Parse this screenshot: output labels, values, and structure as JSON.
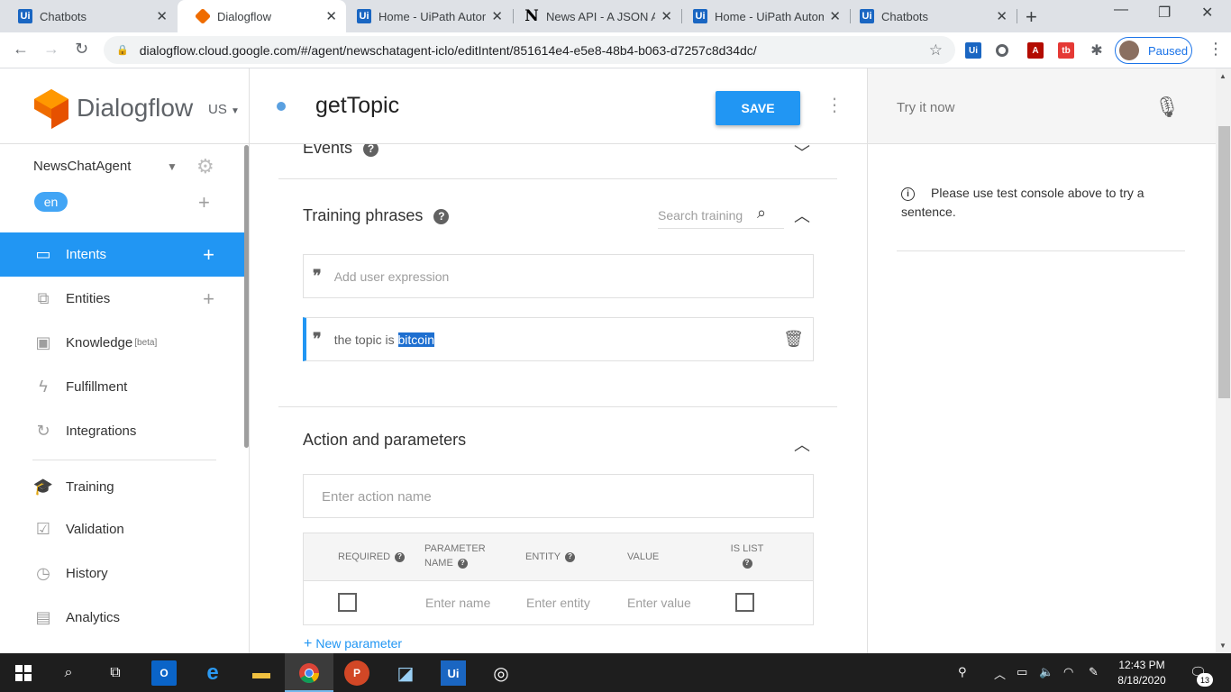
{
  "browser": {
    "tabs": [
      {
        "label": "Chatbots",
        "favicon": "uipath-icon"
      },
      {
        "label": "Dialogflow",
        "favicon": "dialogflow-icon"
      },
      {
        "label": "Home - UiPath Autom",
        "favicon": "uipath-icon"
      },
      {
        "label": "News API - A JSON A",
        "favicon": "newsapi-icon"
      },
      {
        "label": "Home - UiPath Autom",
        "favicon": "uipath-icon"
      },
      {
        "label": "Chatbots",
        "favicon": "uipath-icon"
      }
    ],
    "active_tab": 1,
    "url": "dialogflow.cloud.google.com/#/agent/newschatagent-iclo/editIntent/851614e4-e5e8-48b4-b063-d7257c8d34dc/",
    "profile_label": "Paused"
  },
  "sidebar": {
    "brand": "Dialogflow",
    "region": "US",
    "agent": "NewsChatAgent",
    "language": "en",
    "items": [
      {
        "label": "Intents",
        "icon": "chat-icon",
        "active": true,
        "has_add": true
      },
      {
        "label": "Entities",
        "icon": "hierarchy-icon",
        "active": false,
        "has_add": true
      },
      {
        "label": "Knowledge",
        "badge": "[beta]",
        "icon": "book-icon",
        "active": false
      },
      {
        "label": "Fulfillment",
        "icon": "bolt-icon",
        "active": false
      },
      {
        "label": "Integrations",
        "icon": "refresh-icon",
        "active": false
      },
      {
        "label": "Training",
        "icon": "graduation-icon",
        "active": false
      },
      {
        "label": "Validation",
        "icon": "checkbox-icon",
        "active": false
      },
      {
        "label": "History",
        "icon": "clock-icon",
        "active": false
      },
      {
        "label": "Analytics",
        "icon": "bar-chart-icon",
        "active": false
      }
    ]
  },
  "intent": {
    "name": "getTopic",
    "save_label": "SAVE",
    "events_label": "Events",
    "training": {
      "title": "Training phrases",
      "search_placeholder": "Search training",
      "add_placeholder": "Add user expression",
      "phrases": [
        {
          "prefix": "the topic is ",
          "highlight": "bitcoin"
        }
      ]
    },
    "action": {
      "title": "Action and parameters",
      "placeholder": "Enter action name",
      "columns": [
        "REQUIRED",
        "PARAMETER NAME",
        "ENTITY",
        "VALUE",
        "IS LIST"
      ],
      "row_placeholders": {
        "name": "Enter name",
        "entity": "Enter entity",
        "value": "Enter value"
      },
      "new_parameter_label": "New parameter"
    }
  },
  "console": {
    "try_label": "Try it now",
    "info": "Please use test console above to try a sentence."
  },
  "taskbar": {
    "time": "12:43 PM",
    "date": "8/18/2020",
    "notifications": "13"
  },
  "colors": {
    "primary": "#2196f3",
    "dialogflow_orange": "#ef6c00",
    "highlight": "#1e6fd0"
  }
}
